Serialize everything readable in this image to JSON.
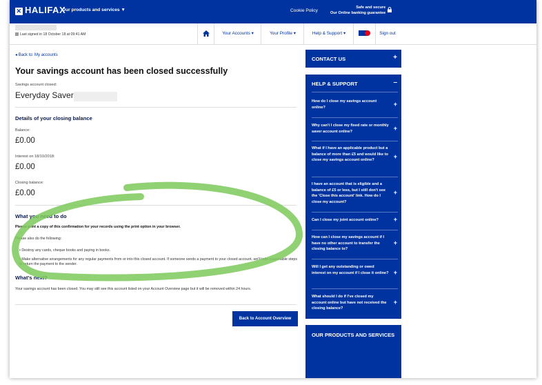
{
  "header": {
    "logo": "HALIFAX",
    "products_menu": "Our products and services",
    "cookie_policy": "Cookie Policy",
    "secure_line1": "Safe and secure",
    "secure_line2": "Our Online banking guarantee"
  },
  "nav": {
    "last_signed": "Last signed in 18 October 18 at 09:41 AM",
    "home_icon": "home-icon",
    "accounts": "Your Accounts",
    "profile": "Your Profile",
    "help": "Help & Support",
    "sign_out": "Sign out"
  },
  "main": {
    "back_link": "Back to: My accounts",
    "title": "Your savings account has been closed successfully",
    "account_closed_label": "Savings account closed:",
    "account_name": "Everyday Saver",
    "details_heading": "Details of your closing balance",
    "balance_label": "Balance:",
    "balance_value": "£0.00",
    "interest_label": "Interest on 18/10/2018:",
    "interest_value": "£0.00",
    "closing_label": "Closing balance:",
    "closing_value": "£0.00",
    "need_heading": "What you need to do",
    "print_note": "Please print a copy of this confirmation for your records using the print option in your browser.",
    "also_do": "Please also do the following:",
    "bullet1": "Destroy any cards, cheque books and paying in books.",
    "bullet2": "Make alternative arrangements for any regular payments from or into this closed account. If someone sends a payment to your closed account, we'll take reasonable steps to return the payment to the sender.",
    "next_heading": "What's next?",
    "next_text": "Your savings account has been closed. You may still see this account listed on your Account Overview page but it will be removed within 24 hours.",
    "back_button": "Back to Account Overview"
  },
  "sidebar": {
    "contact": "CONTACT US",
    "help_heading": "HELP & SUPPORT",
    "faqs": [
      "How do I close my savings account online?",
      "Why can't I close my fixed rate or monthly saver account online?",
      "What if I have an applicable product but a balance of more than £5 and would like to close my savings account online?",
      "I have an account that is eligible and a balance of £5 or less, but I still don't see the 'Close this account' link. How do I close my account?",
      "Can I close my joint account online?",
      "How can I close my savings account if I have no other account to transfer the closing balance to?",
      "Will I get any outstanding or owed interest on my account if I close it online?",
      "What should I do if I've closed my account online but have not received the closing balance?"
    ],
    "products": "OUR PRODUCTS AND SERVICES",
    "plus": "+",
    "minus": "–"
  },
  "colors": {
    "brand_blue": "#0033a0",
    "highlight_green": "#7cc95a"
  }
}
